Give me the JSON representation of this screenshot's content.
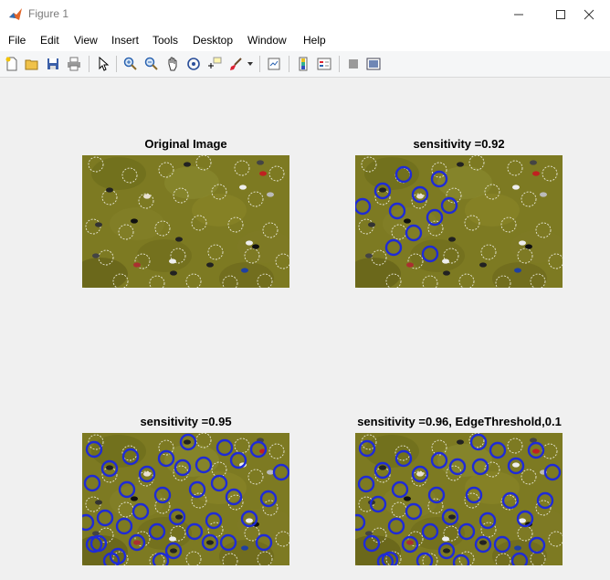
{
  "window": {
    "title": "Figure 1"
  },
  "menu": [
    "File",
    "Edit",
    "View",
    "Insert",
    "Tools",
    "Desktop",
    "Window",
    "Help"
  ],
  "toolbar": [
    "new-figure-icon",
    "open-icon",
    "save-icon",
    "print-icon",
    "pointer-icon",
    "zoom-in-icon",
    "zoom-out-icon",
    "pan-icon",
    "rotate-3d-icon",
    "data-cursor-icon",
    "brush-icon",
    "link-plot-icon",
    "colorbar-icon",
    "legend-icon",
    "hide-plot-tools-icon",
    "show-plot-tools-icon"
  ],
  "panels": [
    {
      "title": "Original Image"
    },
    {
      "title": "sensitivity =0.92"
    },
    {
      "title": "sensitivity =0.95"
    },
    {
      "title": "sensitivity =0.96, EdgeThreshold,0.1"
    }
  ],
  "colors": {
    "detected_circle": "#1f2bd6",
    "grass": "#7d7a22",
    "chalk_circle": "#e8e8d8"
  }
}
